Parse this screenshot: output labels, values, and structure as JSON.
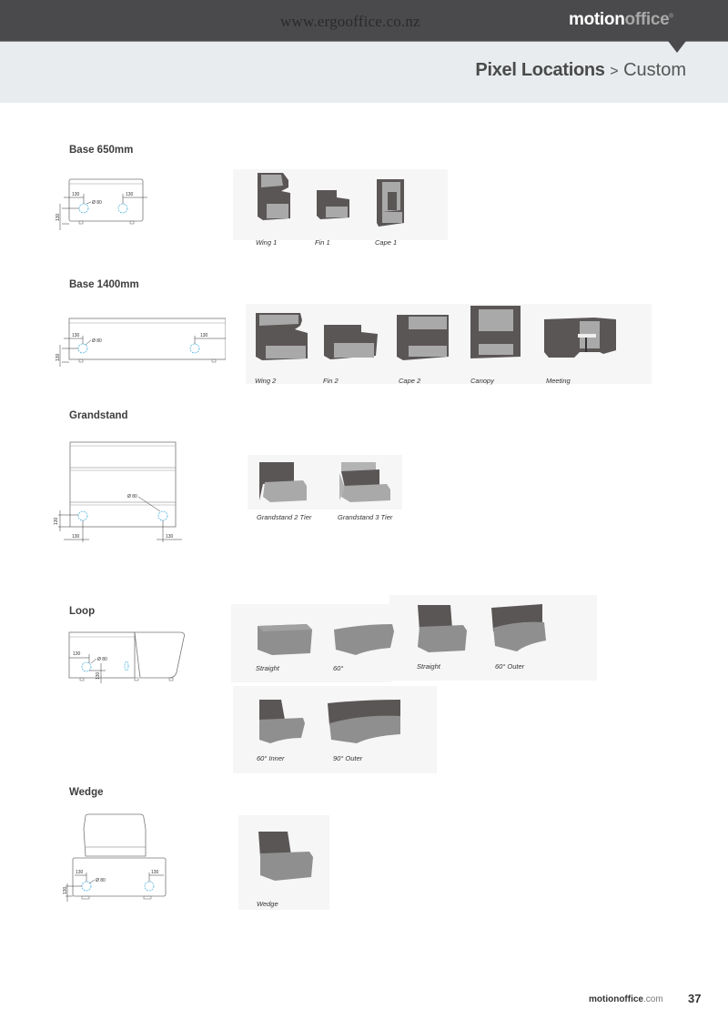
{
  "header": {
    "site_url": "www.ergooffice.co.nz",
    "brand_part1": "motion",
    "brand_part2": "office",
    "brand_mark": "®",
    "breadcrumb_bold": "Pixel Locations",
    "breadcrumb_separator": ">",
    "breadcrumb_current": "Custom"
  },
  "colors": {
    "topbar": "#4a4a4c",
    "subbar": "#e8ecee",
    "pixel_circle": "#4fb3e0",
    "upholstery_dark": "#5a5655",
    "upholstery_light": "#a9a9a9"
  },
  "sections": [
    {
      "title": "Base 650mm",
      "dimensions": {
        "offset": "130",
        "diameter": "Ø 80",
        "height": "130"
      },
      "products": [
        {
          "label": "Wing 1",
          "icon": "wing-chair-icon"
        },
        {
          "label": "Fin 1",
          "icon": "fin-chair-icon"
        },
        {
          "label": "Cape 1",
          "icon": "cape-chair-icon"
        }
      ]
    },
    {
      "title": "Base 1400mm",
      "dimensions": {
        "offset": "130",
        "diameter": "Ø 80",
        "height": "130"
      },
      "products": [
        {
          "label": "Wing 2",
          "icon": "wing-sofa-icon"
        },
        {
          "label": "Fin 2",
          "icon": "fin-sofa-icon"
        },
        {
          "label": "Cape 2",
          "icon": "cape-sofa-icon"
        },
        {
          "label": "Canopy",
          "icon": "canopy-sofa-icon"
        },
        {
          "label": "Meeting",
          "icon": "meeting-booth-icon"
        }
      ]
    },
    {
      "title": "Grandstand",
      "dimensions": {
        "offset": "130",
        "diameter": "Ø 80",
        "height": "130"
      },
      "products": [
        {
          "label": "Grandstand 2 Tier",
          "icon": "grandstand-2-tier-icon"
        },
        {
          "label": "Grandstand 3 Tier",
          "icon": "grandstand-3-tier-icon"
        }
      ]
    },
    {
      "title": "Loop",
      "dimensions": {
        "offset": "130",
        "diameter": "Ø 80",
        "height": "130"
      },
      "products": [
        {
          "label": "Straight",
          "icon": "loop-straight-ottoman-icon"
        },
        {
          "label": "60°",
          "icon": "loop-60-ottoman-icon"
        },
        {
          "label": "Straight",
          "icon": "loop-straight-chair-icon"
        },
        {
          "label": "60° Outer",
          "icon": "loop-60-outer-icon"
        },
        {
          "label": "60° Inner",
          "icon": "loop-60-inner-icon"
        },
        {
          "label": "90° Outer",
          "icon": "loop-90-outer-icon"
        }
      ]
    },
    {
      "title": "Wedge",
      "dimensions": {
        "offset": "130",
        "diameter": "Ø 80",
        "height": "130"
      },
      "products": [
        {
          "label": "Wedge",
          "icon": "wedge-chair-icon"
        }
      ]
    }
  ],
  "footer": {
    "brand_bold": "motionoffice",
    "brand_domain": ".com",
    "page_number": "37"
  }
}
